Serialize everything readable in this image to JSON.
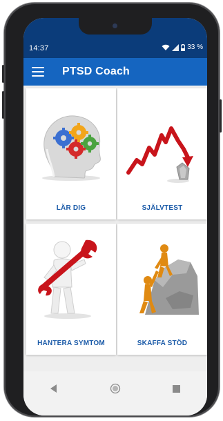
{
  "status_bar": {
    "time": "14:37",
    "battery_percent": "33 %",
    "icons": [
      "wifi-icon",
      "signal-icon",
      "battery-icon"
    ]
  },
  "app_bar": {
    "title": "PTSD Coach",
    "menu_icon": "hamburger-menu-icon",
    "background": "#1565c0"
  },
  "tiles": [
    {
      "label": "LÄR DIG",
      "icon": "head-gears-illustration"
    },
    {
      "label": "SJÄLVTEST",
      "icon": "declining-arrow-illustration"
    },
    {
      "label": "HANTERA SYMTOM",
      "icon": "figure-with-wrench-illustration"
    },
    {
      "label": "SKAFFA STÖD",
      "icon": "climbers-helping-illustration"
    }
  ],
  "nav_bar": {
    "buttons": [
      "back-icon",
      "home-icon",
      "recents-icon"
    ]
  },
  "colors": {
    "status_bar": "#0b3c7a",
    "accent": "#1565c0",
    "tile_label": "#1a5aa8",
    "background": "#eeeeee"
  }
}
